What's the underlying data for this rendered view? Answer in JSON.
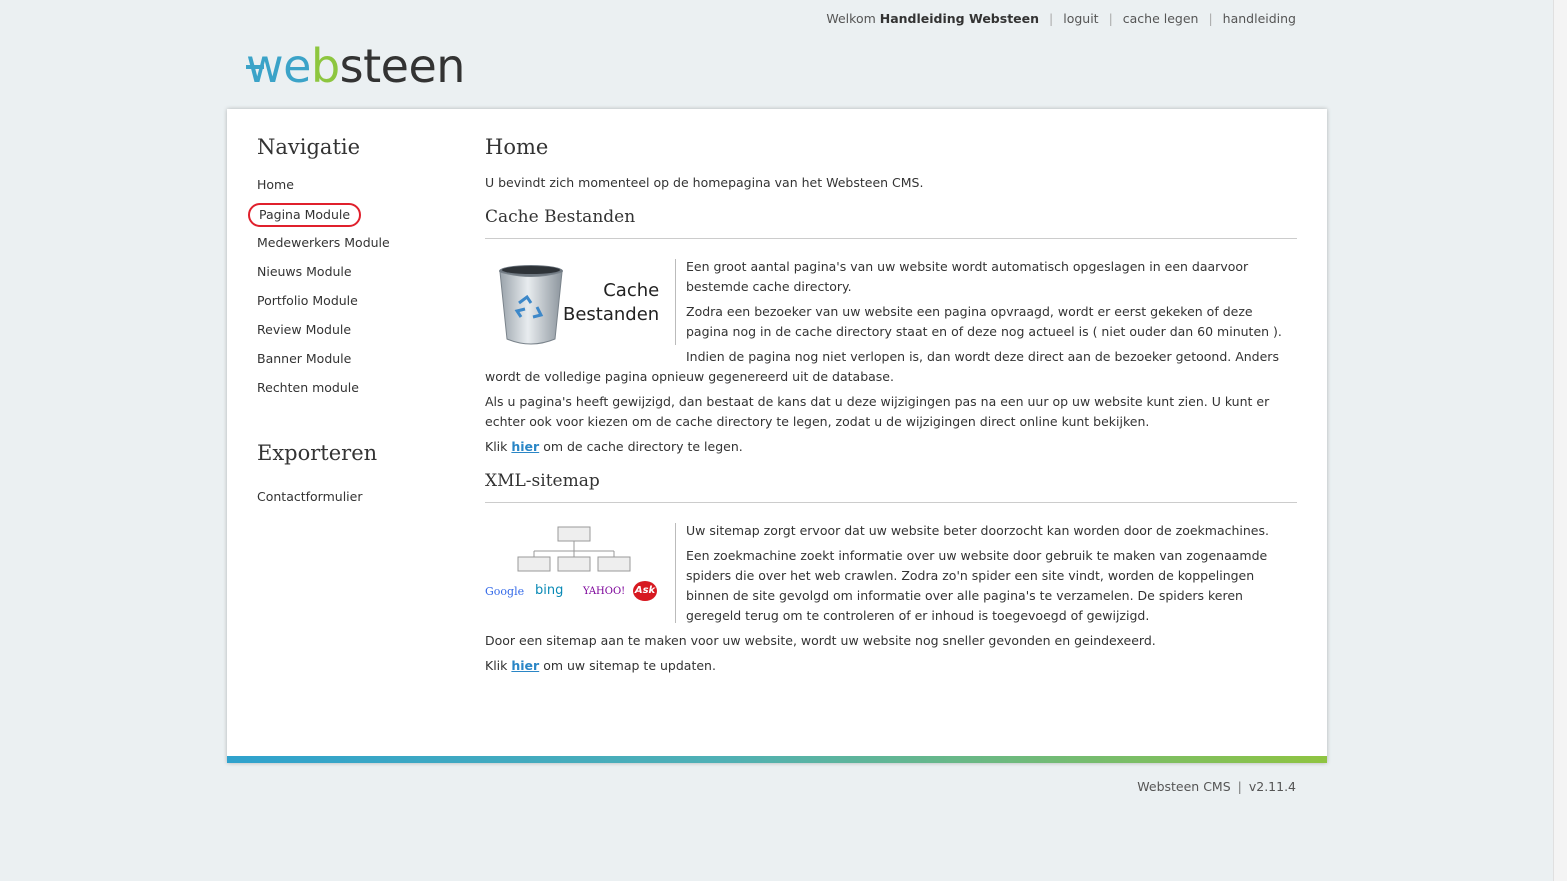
{
  "header": {
    "welcome_prefix": "Welkom",
    "user_name": "Handleiding Websteen",
    "links": [
      "loguit",
      "cache legen",
      "handleiding"
    ]
  },
  "logo": {
    "part1": "web",
    "part2": "steen"
  },
  "sidebar": {
    "nav_title": "Navigatie",
    "items": [
      "Home",
      "Pagina Module",
      "Medewerkers Module",
      "Nieuws Module",
      "Portfolio Module",
      "Review Module",
      "Banner Module",
      "Rechten module"
    ],
    "export_title": "Exporteren",
    "export_items": [
      "Contactformulier"
    ]
  },
  "main": {
    "title": "Home",
    "intro": "U bevindt zich momenteel op de homepagina van het Websteen CMS.",
    "cache": {
      "title": "Cache Bestanden",
      "image_label_1": "Cache",
      "image_label_2": "Bestanden",
      "p1": "Een groot aantal pagina's van uw website wordt automatisch opgeslagen in een daarvoor bestemde cache directory.",
      "p2": "Zodra een bezoeker van uw website een pagina opvraagd, wordt er eerst gekeken of deze pagina nog in de cache directory staat en of deze nog actueel is ( niet ouder dan 60 minuten ).",
      "p3": "Indien de pagina nog niet verlopen is, dan wordt deze direct aan de bezoeker getoond. Anders wordt de volledige pagina opnieuw gegenereerd uit de database.",
      "p4": "Als u pagina's heeft gewijzigd, dan bestaat de kans dat u deze wijzigingen pas na een uur op uw website kunt zien. U kunt er echter ook voor kiezen om de cache directory te legen, zodat u de wijzigingen direct online kunt bekijken.",
      "click_prefix": "Klik",
      "click_link": "hier",
      "click_suffix": "om de cache directory te legen."
    },
    "sitemap": {
      "title": "XML-sitemap",
      "engines": [
        "Google",
        "bing",
        "YAHOO!",
        "Ask"
      ],
      "p1": "Uw sitemap zorgt ervoor dat uw website beter doorzocht kan worden door de zoekmachines.",
      "p2": "Een zoekmachine zoekt informatie over uw website door gebruik te maken van zogenaamde spiders die over het web crawlen. Zodra zo'n spider een site vindt, worden de koppelingen binnen de site gevolgd om informatie over alle pagina's te verzamelen. De spiders keren geregeld terug om te controleren of er inhoud is toegevoegd of gewijzigd.",
      "p3": "Door een sitemap aan te maken voor uw website, wordt uw website nog sneller gevonden en geindexeerd.",
      "click_prefix": "Klik",
      "click_link": "hier",
      "click_suffix": "om uw sitemap te updaten."
    }
  },
  "footer": {
    "product": "Websteen CMS",
    "version": "v2.11.4"
  },
  "colors": {
    "accent_blue": "#3ba3c8",
    "accent_green": "#8dc63f",
    "link": "#2a86c6",
    "highlight_circle": "#e0202c"
  }
}
